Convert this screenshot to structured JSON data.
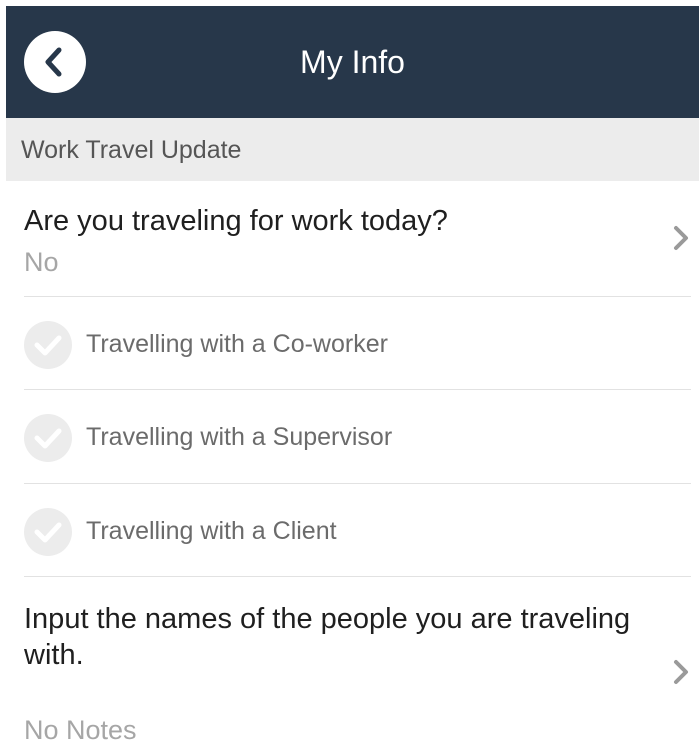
{
  "header": {
    "title": "My Info",
    "back_icon": "chevron-left-icon"
  },
  "section": {
    "label": "Work Travel Update"
  },
  "question": {
    "title": "Are you traveling for work today?",
    "value": "No"
  },
  "options": [
    {
      "label": "Travelling with a Co-worker",
      "checked": false
    },
    {
      "label": "Travelling with a Supervisor",
      "checked": false
    },
    {
      "label": "Travelling with a Client",
      "checked": false
    }
  ],
  "notes": {
    "title": "Input the names of the people you are traveling with.",
    "value": "No Notes"
  },
  "colors": {
    "header_bg": "#27374a",
    "section_bg": "#ececec",
    "muted_text": "#a6a6a6",
    "chevron": "#9a9a9a"
  }
}
